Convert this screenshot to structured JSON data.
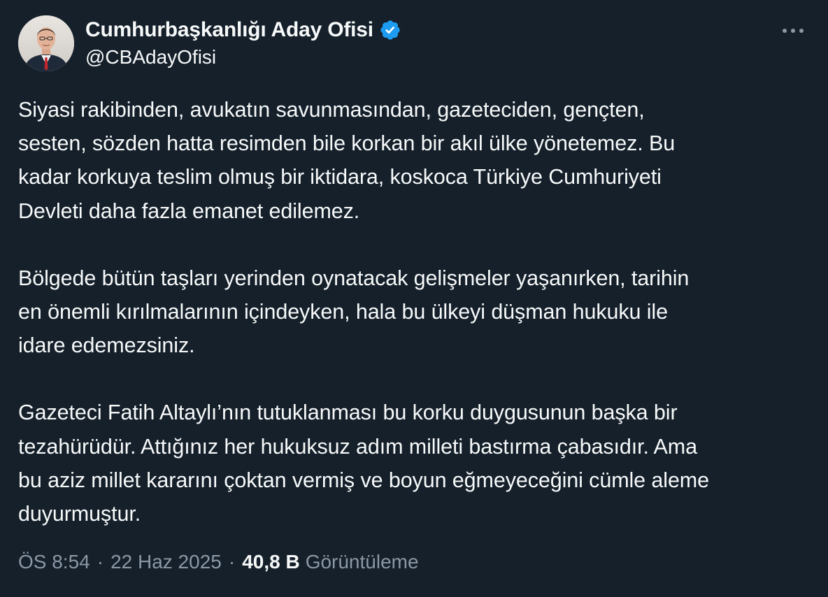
{
  "author": {
    "display_name": "Cumhurbaşkanlığı Aday Ofisi",
    "handle": "@CBAdayOfisi",
    "verified": true,
    "avatar_icon": "profile-photo",
    "verified_icon": "verified-badge-icon",
    "verified_color": "#1d9bf0"
  },
  "more_icon": "more-options-icon",
  "tweet": {
    "paragraphs": [
      "Siyasi rakibinden, avukatın savunmasından, gazeteciden, gençten,\nsesten, sözden hatta resimden bile korkan bir akıl ülke yönetemez. Bu\nkadar korkuya teslim olmuş bir iktidara, koskoca Türkiye Cumhuriyeti\nDevleti daha fazla emanet edilemez.",
      "Bölgede bütün taşları yerinden oynatacak gelişmeler yaşanırken, tarihin\nen önemli kırılmalarının içindeyken, hala bu ülkeyi düşman hukuku ile\nidare edemezsiniz.",
      "Gazeteci Fatih Altaylı’nın tutuklanması bu korku duygusunun başka bir\ntezahürüdür. Attığınız her hukuksuz adım milleti bastırma çabasıdır. Ama\nbu aziz millet kararını çoktan vermiş ve boyun eğmeyeceğini cümle aleme\nduyurmuştur."
    ]
  },
  "meta": {
    "time": "ÖS 8:54",
    "separator": "·",
    "date": "22 Haz 2025",
    "views_count": "40,8 B",
    "views_label": "Görüntüleme"
  },
  "colors": {
    "background": "#15202b",
    "primary_text": "#f7f9f9",
    "secondary_text": "#8b98a5"
  }
}
